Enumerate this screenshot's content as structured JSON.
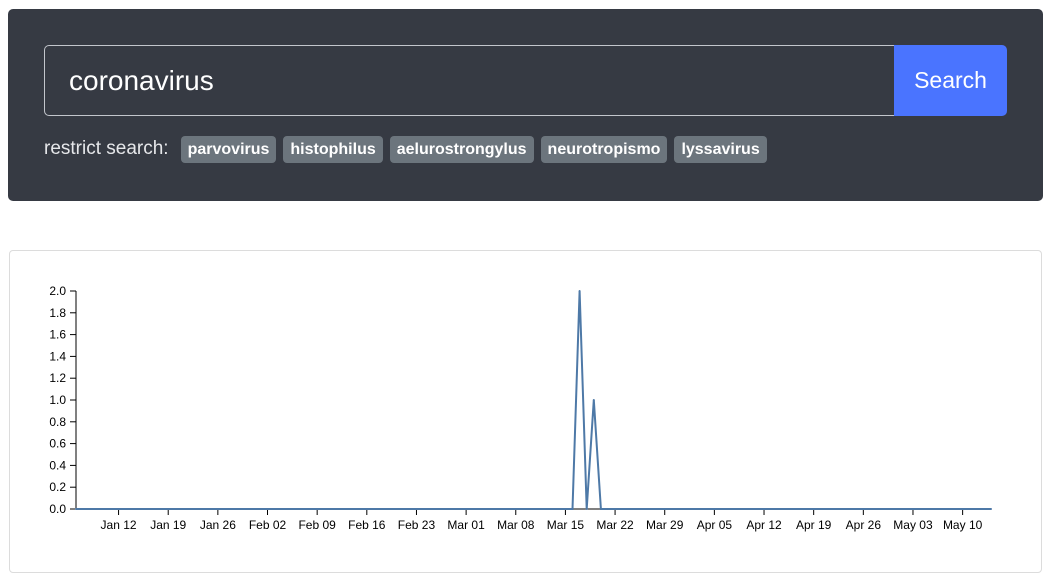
{
  "search": {
    "value": "coronavirus",
    "button_label": "Search"
  },
  "restrict": {
    "label": "restrict search:",
    "tags": [
      "parvovirus",
      "histophilus",
      "aelurostrongylus",
      "neurotropismo",
      "lyssavirus"
    ]
  },
  "colors": {
    "panel_bg": "#363a43",
    "button_bg": "#4a74ff",
    "tag_bg": "#6c757d",
    "line": "#4e79a7"
  },
  "chart_data": {
    "type": "line",
    "ylim": [
      0,
      2.0
    ],
    "y_ticks": [
      "0.0",
      "0.2",
      "0.4",
      "0.6",
      "0.8",
      "1.0",
      "1.2",
      "1.4",
      "1.6",
      "1.8",
      "2.0"
    ],
    "x_ticks": [
      "Jan 12",
      "Jan 19",
      "Jan 26",
      "Feb 02",
      "Feb 09",
      "Feb 16",
      "Feb 23",
      "Mar 01",
      "Mar 08",
      "Mar 15",
      "Mar 22",
      "Mar 29",
      "Apr 05",
      "Apr 12",
      "Apr 19",
      "Apr 26",
      "May 03",
      "May 10"
    ],
    "x": [
      "Jan 06",
      "Mar 16",
      "Mar 17",
      "Mar 18",
      "Mar 19",
      "Mar 20",
      "Mar 21",
      "May 14"
    ],
    "values": [
      0,
      0,
      2,
      0,
      1,
      0,
      0,
      0
    ]
  }
}
